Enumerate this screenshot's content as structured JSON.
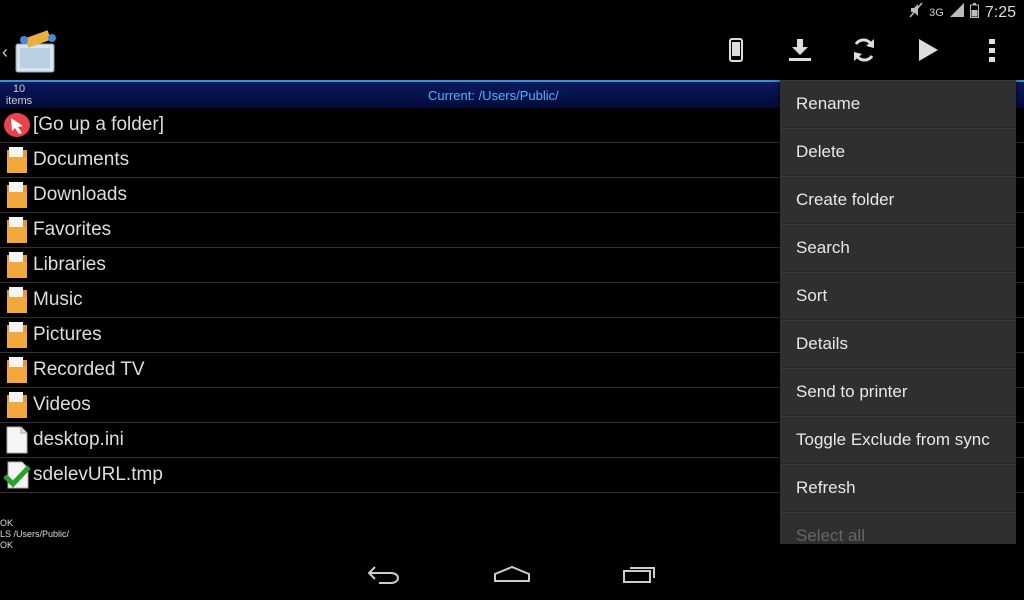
{
  "status": {
    "time": "7:25",
    "network": "3G"
  },
  "header": {
    "back_icon": "chevron-left-icon",
    "app_icon": "folder-sync-icon"
  },
  "actions": [
    {
      "name": "device-button",
      "icon": "phone-icon"
    },
    {
      "name": "download-button",
      "icon": "download-icon"
    },
    {
      "name": "sync-button",
      "icon": "refresh-icon"
    },
    {
      "name": "play-button",
      "icon": "play-icon"
    },
    {
      "name": "overflow-menu-button",
      "icon": "more-vert-icon"
    }
  ],
  "path": {
    "count": "10",
    "count_label": "items",
    "current": "Current: /Users/Public/"
  },
  "files": [
    {
      "name": "[Go up a folder]",
      "type": "up"
    },
    {
      "name": "Documents",
      "type": "folder"
    },
    {
      "name": "Downloads",
      "type": "folder"
    },
    {
      "name": "Favorites",
      "type": "folder"
    },
    {
      "name": "Libraries",
      "type": "folder"
    },
    {
      "name": "Music",
      "type": "folder"
    },
    {
      "name": "Pictures",
      "type": "folder"
    },
    {
      "name": "Recorded TV",
      "type": "folder"
    },
    {
      "name": "Videos",
      "type": "folder"
    },
    {
      "name": "desktop.ini",
      "type": "file"
    },
    {
      "name": "sdelevURL.tmp",
      "type": "checked"
    }
  ],
  "log": [
    "OK",
    "LS /Users/Public/",
    "OK"
  ],
  "menu": [
    "Rename",
    "Delete",
    "Create folder",
    "Search",
    "Sort",
    "Details",
    "Send to printer",
    "Toggle Exclude from sync",
    "Refresh",
    "Select all"
  ],
  "colors": {
    "accent": "#3a8fd6",
    "path_text": "#4db4ff",
    "menu_bg": "#2f2f2f",
    "folder": "#f0a030"
  }
}
